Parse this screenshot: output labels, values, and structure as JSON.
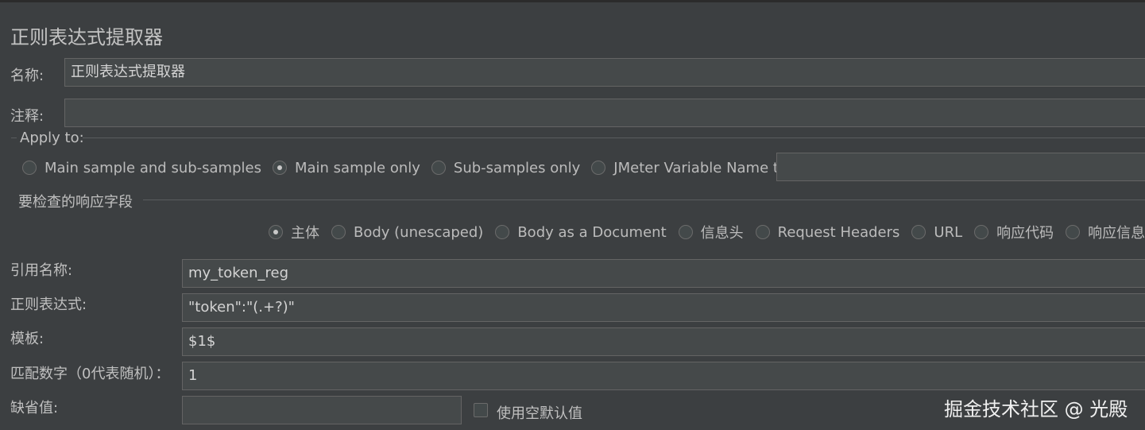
{
  "panel": {
    "title": "正则表达式提取器"
  },
  "name_field": {
    "label": "名称:",
    "value": "正则表达式提取器"
  },
  "comment_field": {
    "label": "注释:",
    "value": ""
  },
  "apply_to": {
    "legend": "Apply to:",
    "options": [
      {
        "label": "Main sample and sub-samples",
        "selected": false
      },
      {
        "label": "Main sample only",
        "selected": true
      },
      {
        "label": "Sub-samples only",
        "selected": false
      },
      {
        "label": "JMeter Variable Name to use",
        "selected": false
      }
    ],
    "variable_value": ""
  },
  "field_to_check": {
    "legend": "要检查的响应字段",
    "options": [
      {
        "label": "主体",
        "selected": true
      },
      {
        "label": "Body (unescaped)",
        "selected": false
      },
      {
        "label": "Body as a Document",
        "selected": false
      },
      {
        "label": "信息头",
        "selected": false
      },
      {
        "label": "Request Headers",
        "selected": false
      },
      {
        "label": "URL",
        "selected": false
      },
      {
        "label": "响应代码",
        "selected": false
      },
      {
        "label": "响应信息",
        "selected": false
      }
    ]
  },
  "form": {
    "ref_name": {
      "label": "引用名称:",
      "value": "my_token_reg"
    },
    "regex": {
      "label": "正则表达式:",
      "value": "\"token\":\"(.+?)\""
    },
    "template": {
      "label": "模板:",
      "value": "$1$"
    },
    "match_no": {
      "label": "匹配数字（0代表随机）：",
      "value": "1"
    },
    "default_value": {
      "label": "缺省值:",
      "value": ""
    },
    "use_empty_default": {
      "label": "使用空默认值",
      "checked": false
    }
  },
  "watermark": "掘金技术社区 @ 光殿"
}
